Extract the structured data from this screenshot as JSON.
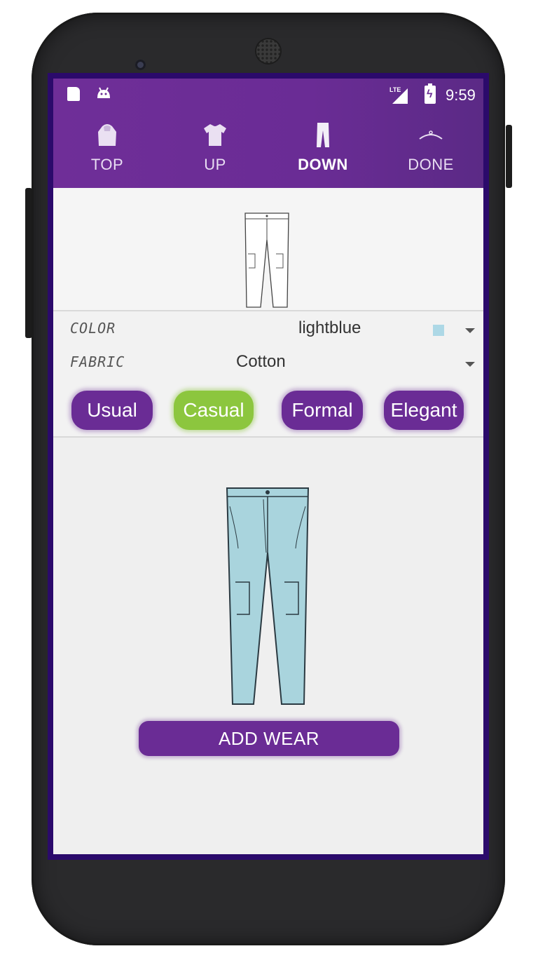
{
  "status_bar": {
    "network": "LTE",
    "time": "9:59"
  },
  "tabs": [
    {
      "label": "TOP",
      "icon": "hoodie-icon",
      "active": false
    },
    {
      "label": "UP",
      "icon": "tshirt-icon",
      "active": false
    },
    {
      "label": "DOWN",
      "icon": "pants-icon",
      "active": true
    },
    {
      "label": "DONE",
      "icon": "hanger-icon",
      "active": false
    }
  ],
  "form": {
    "color_label": "COLOR",
    "color_value": "lightblue",
    "color_swatch": "#add8e6",
    "fabric_label": "FABRIC",
    "fabric_value": "Cotton"
  },
  "styles": [
    {
      "label": "Usual",
      "selected": false
    },
    {
      "label": "Casual",
      "selected": true
    },
    {
      "label": "Formal",
      "selected": false
    },
    {
      "label": "Elegant",
      "selected": false
    }
  ],
  "add_button": "ADD WEAR",
  "colors": {
    "primary": "#6a2c95",
    "selected_chip": "#8cc63e",
    "garment_fill": "#a9d4dd"
  }
}
